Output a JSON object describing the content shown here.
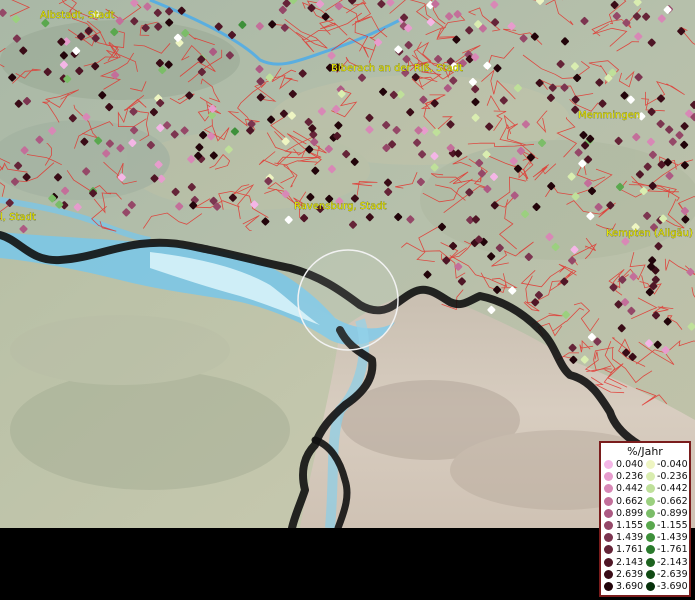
{
  "map": {
    "cities": [
      {
        "name": "Albstadt, Stadt"
      },
      {
        "name": "Biberach an der Riß, Stadt"
      },
      {
        "name": "Memmingen"
      },
      {
        "name": "Ravensburg, Stadt"
      },
      {
        "name": "Kempten (Allgäu)"
      },
      {
        "name": "l, Stadt"
      }
    ]
  },
  "legend": {
    "title": "%/Jahr",
    "rows": [
      {
        "pos": "0.040",
        "neg": "-0.040",
        "pos_color": "#f4b6e6",
        "neg_color": "#eef5c2"
      },
      {
        "pos": "0.236",
        "neg": "-0.236",
        "pos_color": "#e79ccd",
        "neg_color": "#d9edb0"
      },
      {
        "pos": "0.442",
        "neg": "-0.442",
        "pos_color": "#d888b6",
        "neg_color": "#bfe09a"
      },
      {
        "pos": "0.662",
        "neg": "-0.662",
        "pos_color": "#c36f9a",
        "neg_color": "#9bd07f"
      },
      {
        "pos": "0.899",
        "neg": "-0.899",
        "pos_color": "#ad5a83",
        "neg_color": "#7bbd68"
      },
      {
        "pos": "1.155",
        "neg": "-1.155",
        "pos_color": "#954868",
        "neg_color": "#5aa84e"
      },
      {
        "pos": "1.439",
        "neg": "-1.439",
        "pos_color": "#7c3550",
        "neg_color": "#3e903a"
      },
      {
        "pos": "1.761",
        "neg": "-1.761",
        "pos_color": "#652438",
        "neg_color": "#2a7a2c"
      },
      {
        "pos": "2.143",
        "neg": "-2.143",
        "pos_color": "#4f1626",
        "neg_color": "#1d631f"
      },
      {
        "pos": "2.639",
        "neg": "-2.639",
        "pos_color": "#3a0c17",
        "neg_color": "#114a14"
      },
      {
        "pos": "3.690",
        "neg": "-3.690",
        "pos_color": "#22040a",
        "neg_color": "#06300a"
      }
    ]
  }
}
